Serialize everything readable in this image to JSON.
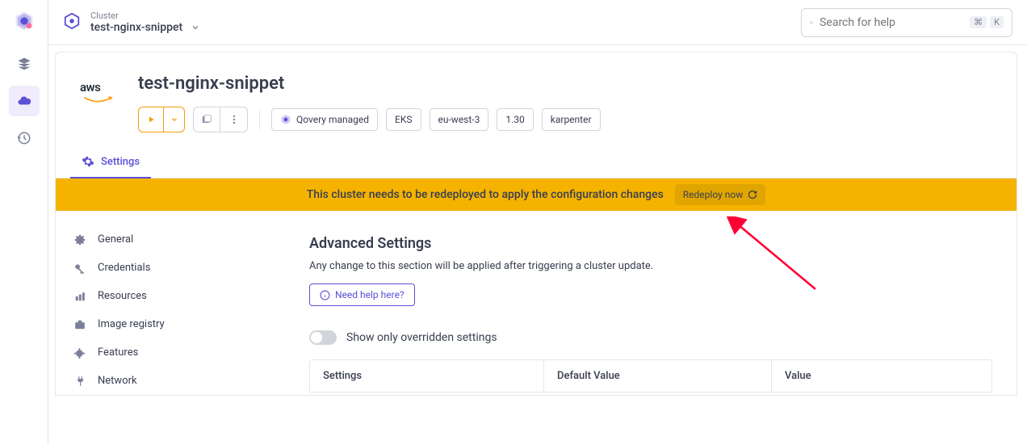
{
  "topbar": {
    "cluster_label": "Cluster",
    "cluster_name": "test-nginx-snippet",
    "search_placeholder": "Search for help",
    "kbd_cmd": "⌘",
    "kbd_k": "K"
  },
  "header": {
    "title": "test-nginx-snippet",
    "pills": {
      "managed": "Qovery managed",
      "service": "EKS",
      "region": "eu-west-3",
      "version": "1.30",
      "autoscaler": "karpenter"
    }
  },
  "tabs": {
    "settings": "Settings"
  },
  "banner": {
    "text": "This cluster needs to be redeployed to apply the configuration changes",
    "button": "Redeploy now"
  },
  "settings_nav": {
    "general": "General",
    "credentials": "Credentials",
    "resources": "Resources",
    "image_registry": "Image registry",
    "features": "Features",
    "network": "Network"
  },
  "advanced": {
    "title": "Advanced Settings",
    "desc": "Any change to this section will be applied after triggering a cluster update.",
    "help": "Need help here?",
    "toggle_label": "Show only overridden settings",
    "table": {
      "col_settings": "Settings",
      "col_default": "Default Value",
      "col_value": "Value"
    }
  }
}
